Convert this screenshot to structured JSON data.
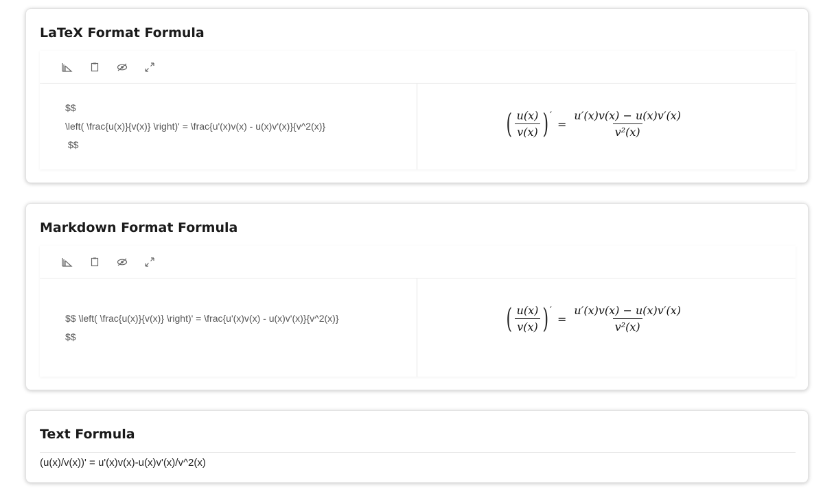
{
  "sections": [
    {
      "title": "LaTeX Format Formula",
      "source_lines": [
        "$$",
        "\\left( \\frac{u(x)}{v(x)} \\right)' = \\frac{u'(x)v(x) - u(x)v'(x)}{v^2(x)}",
        " $$"
      ],
      "rendered": {
        "lhs_num": "u(x)",
        "lhs_den": "v(x)",
        "prime": "′",
        "eq": "=",
        "rhs_num": "u′(x)v(x) − u(x)v′(x)",
        "rhs_den": "v²(x)"
      }
    },
    {
      "title": "Markdown Format Formula",
      "source_lines": [
        "$$ \\left( \\frac{u(x)}{v(x)} \\right)' = \\frac{u'(x)v(x) - u(x)v'(x)}{v^2(x)}",
        "$$"
      ],
      "rendered": {
        "lhs_num": "u(x)",
        "lhs_den": "v(x)",
        "prime": "′",
        "eq": "=",
        "rhs_num": "u′(x)v(x) − u(x)v′(x)",
        "rhs_den": "v²(x)"
      }
    },
    {
      "title": "Text Formula",
      "text": "(u(x)/v(x))' = u'(x)v(x)-u(x)v'(x)/v^2(x)"
    }
  ],
  "toolbar_icons": [
    "ruler-icon",
    "clipboard-icon",
    "eye-off-icon",
    "expand-icon"
  ]
}
